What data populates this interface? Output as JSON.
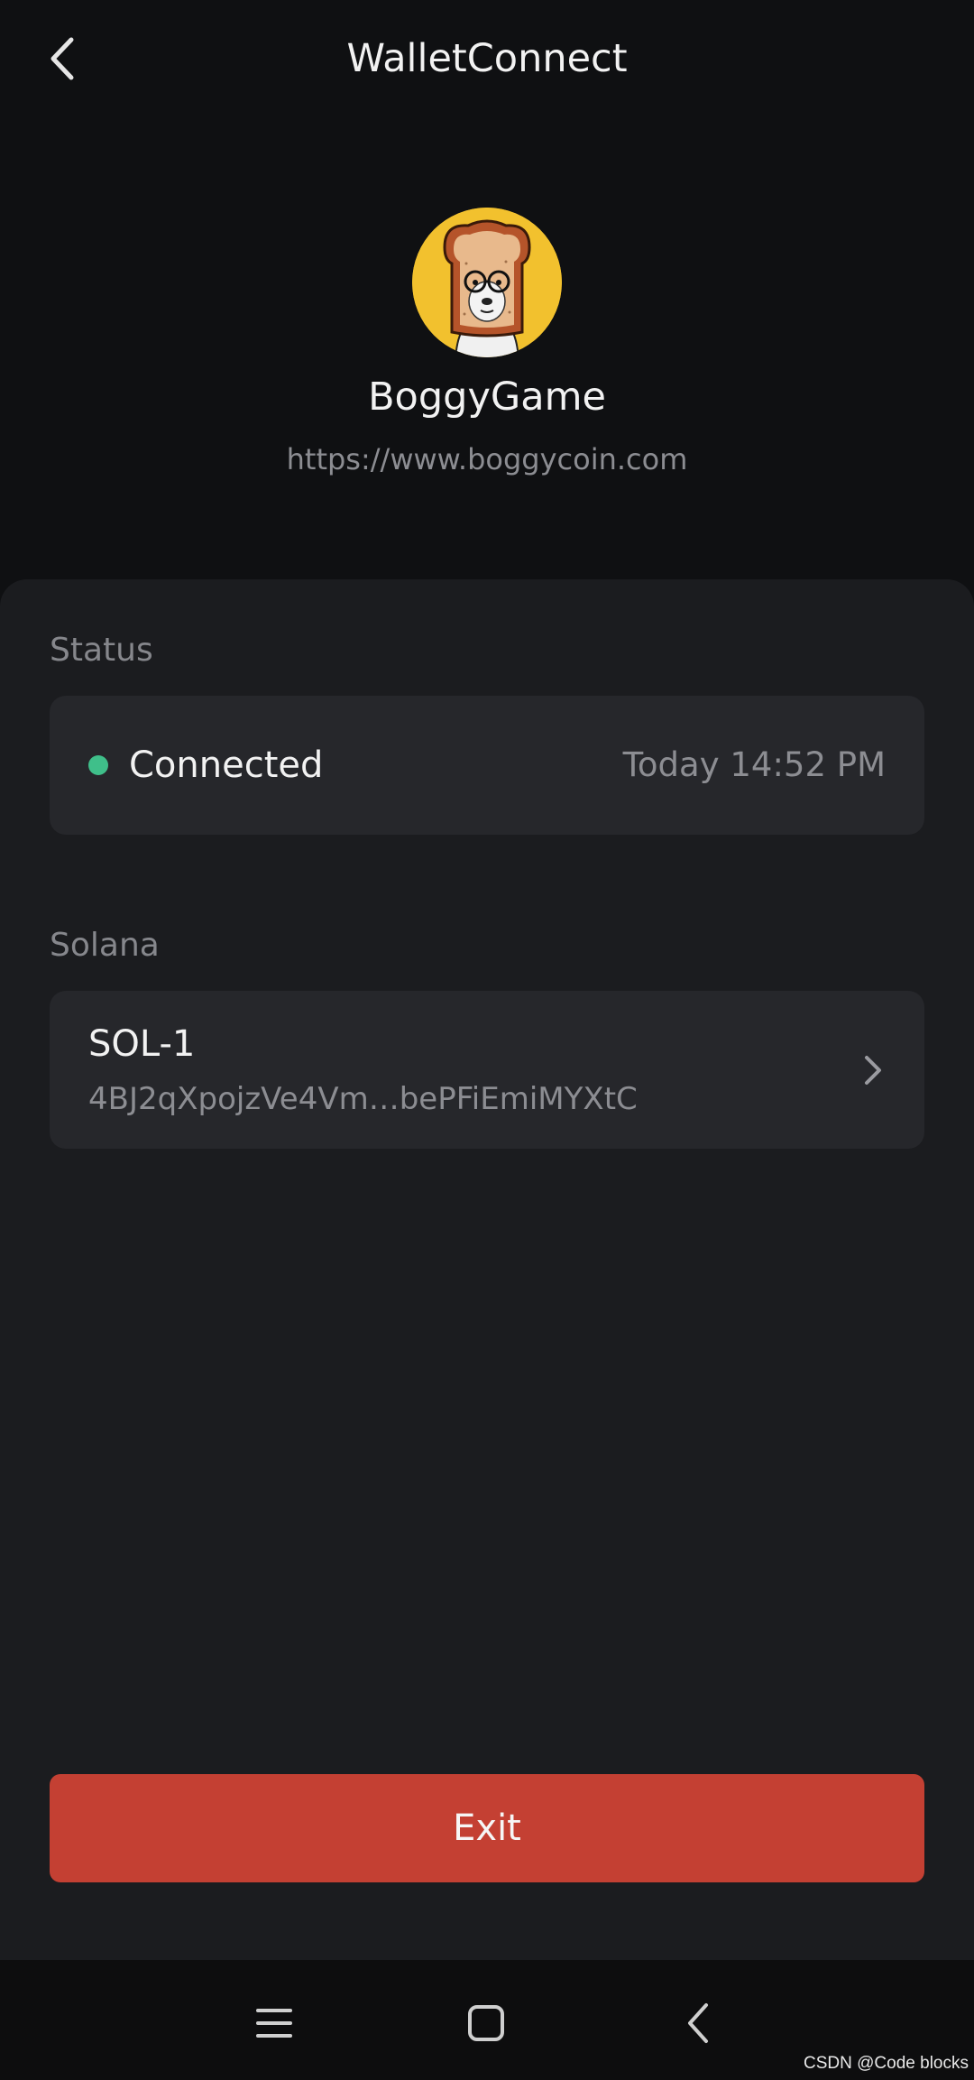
{
  "header": {
    "title": "WalletConnect",
    "back_icon": "chevron-left-icon"
  },
  "dapp": {
    "name": "BoggyGame",
    "url": "https://www.boggycoin.com",
    "logo_color": "#f2c12e"
  },
  "status": {
    "section_label": "Status",
    "state": "Connected",
    "state_color": "#3fbf8a",
    "time": "Today 14:52 PM"
  },
  "accounts": {
    "section_label": "Solana",
    "items": [
      {
        "name": "SOL-1",
        "address": "4BJ2qXpojzVe4Vm…bePFiEmiMYXtC",
        "icon": "chevron-right-icon"
      }
    ]
  },
  "actions": {
    "exit_label": "Exit",
    "exit_color": "#c44033"
  },
  "system_nav": {
    "menu_icon": "menu-icon",
    "home_icon": "home-icon",
    "back_icon": "back-icon"
  },
  "watermark": "CSDN @Code blocks"
}
